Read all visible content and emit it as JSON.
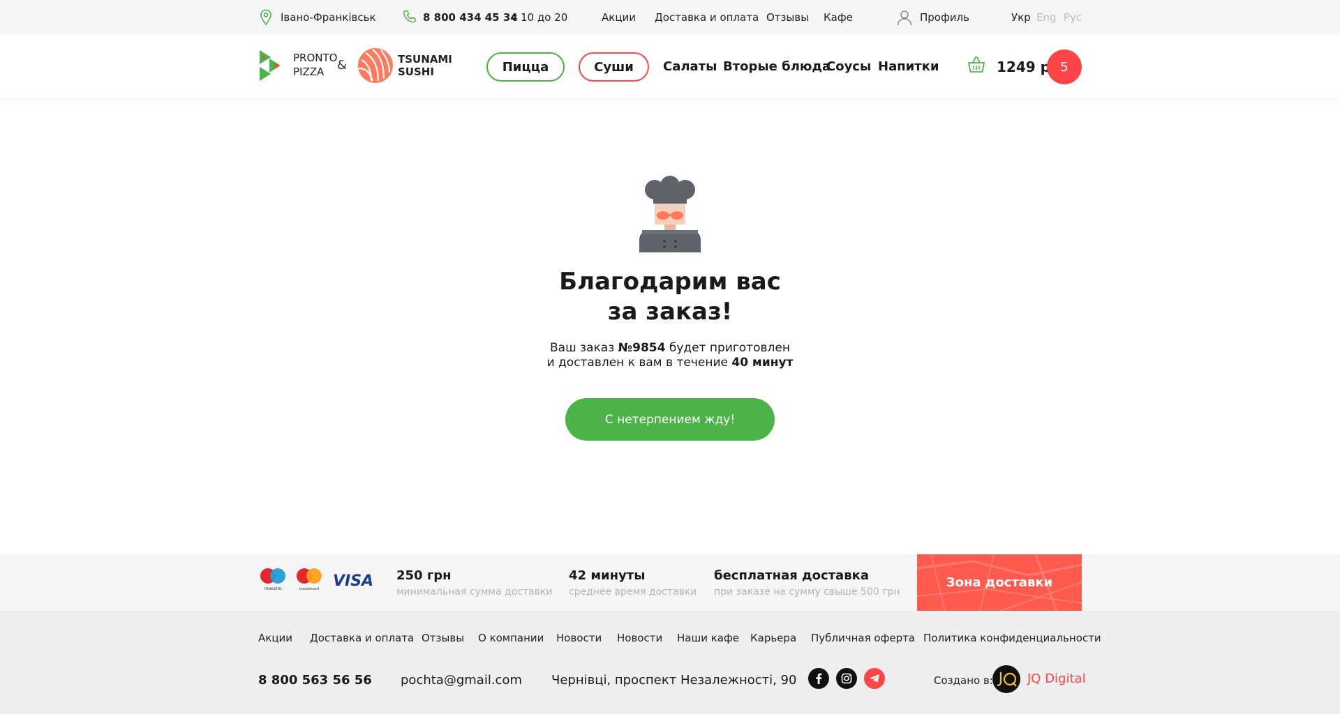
{
  "topbar": {
    "city": "Івано-Франківськ",
    "phone": "8 800 434 45 34",
    "hours": "с 10 до 20",
    "links": [
      "Акции",
      "Доставка и оплата",
      "Отзывы",
      "Кафе"
    ],
    "profile": "Профиль",
    "languages": [
      {
        "label": "Укр",
        "active": true
      },
      {
        "label": "Eng",
        "active": false
      },
      {
        "label": "Рус",
        "active": false
      }
    ]
  },
  "header": {
    "logo_pronto": [
      "PRONTO",
      "PIZZA"
    ],
    "ampersand": "&",
    "logo_tsunami": [
      "TSUNAMI",
      "SUSHI"
    ],
    "nav": {
      "pizza": "Пицца",
      "sushi": "Суши",
      "salads": "Салаты",
      "mains": "Вторые блюда",
      "sauces": "Соусы",
      "drinks": "Напитки"
    },
    "cart_sum": "1249 р",
    "cart_count": "5"
  },
  "main": {
    "title_line1": "Благодарим вас",
    "title_line2": "за заказ!",
    "desc_prefix": "Ваш заказ",
    "order_number": "№9854",
    "desc_middle": "будет приготовлен и доставлен к вам в течение",
    "eta": "40 минут",
    "cta": "С нетерпением жду!"
  },
  "strip": {
    "payment_icons": [
      "maestro-logo",
      "mastercard-logo",
      "visa-logo"
    ],
    "min_sum_value": "250 грн",
    "min_sum_label": "минимальная сумма доставки",
    "avg_time_value": "42 минуты",
    "avg_time_label": "среднее время доставки",
    "free_delivery_value": "бесплатная доставка",
    "free_delivery_label": "при заказе на сумму свыше 500 грн",
    "zone_label": "Зона доставки"
  },
  "footer": {
    "links": [
      "Акции",
      "Доставка и оплата",
      "Отзывы",
      "О компании",
      "Новости",
      "Новости",
      "Наши кафе",
      "Карьера",
      "Публичная оферта",
      "Политика конфиденциальности"
    ],
    "phone": "8 800 563 56 56",
    "email": "pochta@gmail.com",
    "address": "Чернівці, проспект Незалежності, 90",
    "social": [
      "facebook-icon",
      "instagram-icon",
      "telegram-icon"
    ],
    "made_by_label": "Создано в:",
    "made_by_name": "JQ Digital"
  },
  "colors": {
    "green": "#4bb347",
    "red": "#ff4545",
    "coral": "#ff5a4e",
    "gray_text": "#b5b5b5"
  }
}
